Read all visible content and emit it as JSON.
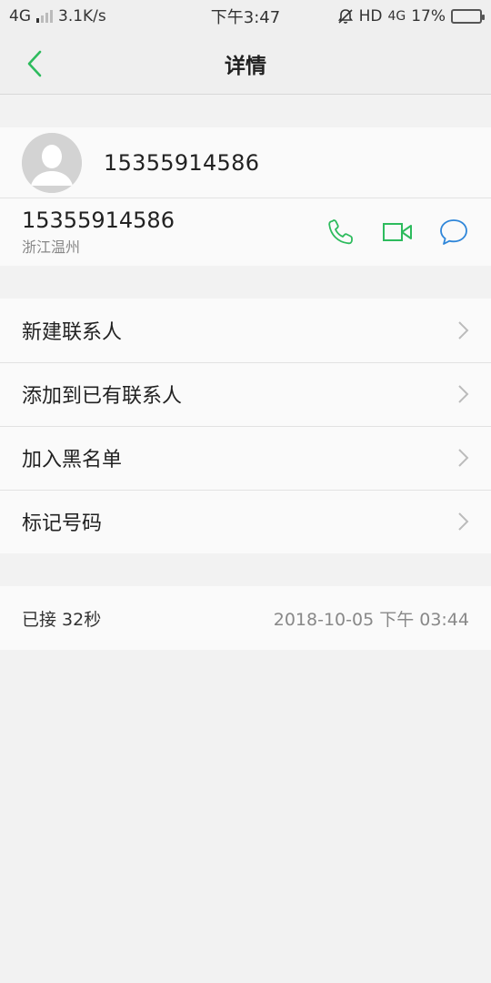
{
  "status_bar": {
    "network": "4G",
    "speed": "3.1K/s",
    "time": "下午3:47",
    "hd": "HD",
    "network_right": "4G",
    "battery_percent": "17%",
    "battery_level": 0.17
  },
  "header": {
    "title": "详情"
  },
  "contact": {
    "name": "15355914586",
    "number": "15355914586",
    "location": "浙江温州"
  },
  "menu": {
    "items": [
      {
        "label": "新建联系人"
      },
      {
        "label": "添加到已有联系人"
      },
      {
        "label": "加入黑名单"
      },
      {
        "label": "标记号码"
      }
    ]
  },
  "call_log": {
    "status": "已接 32秒",
    "datetime": "2018-10-05 下午 03:44"
  },
  "colors": {
    "accent_green": "#2dbb5d",
    "accent_blue": "#2f86d9"
  }
}
